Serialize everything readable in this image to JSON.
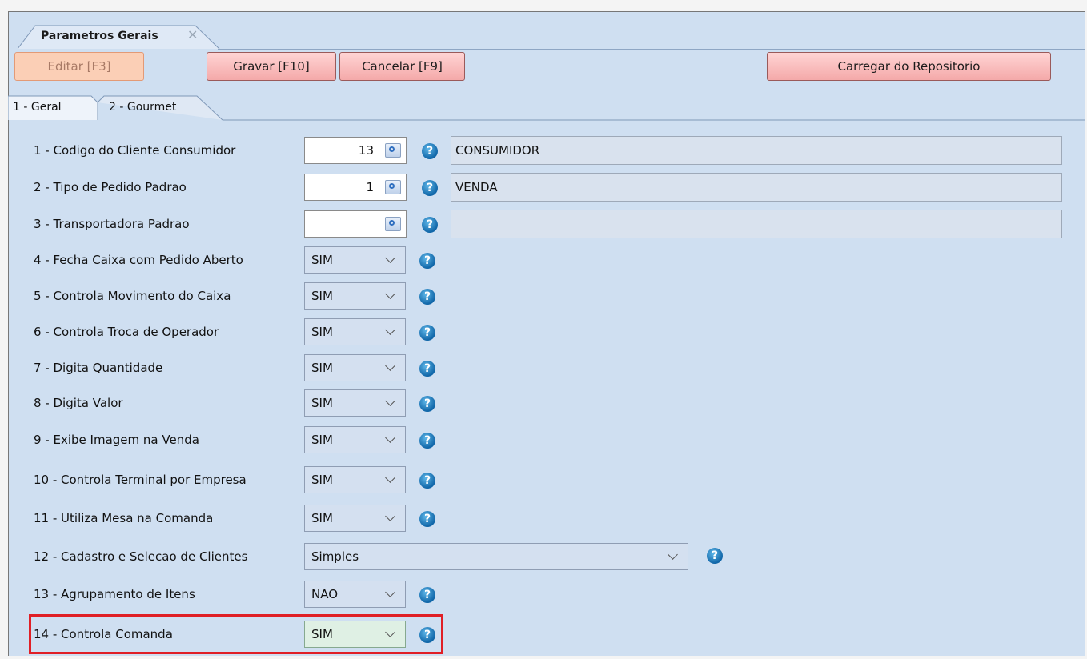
{
  "window": {
    "tab_title": "Parametros Gerais",
    "tab_close": "✕"
  },
  "toolbar": {
    "edit_label": "Editar [F3]",
    "save_label": "Gravar [F10]",
    "cancel_label": "Cancelar [F9]",
    "load_label": "Carregar do Repositorio"
  },
  "tabs": [
    {
      "label": "1 - Geral",
      "active": true
    },
    {
      "label": "2 - Gourmet",
      "active": false
    }
  ],
  "fields": [
    {
      "label": "1 - Codigo do Cliente Consumidor",
      "type": "lookup",
      "value": "13",
      "description": "CONSUMIDOR"
    },
    {
      "label": "2 - Tipo de Pedido Padrao",
      "type": "lookup",
      "value": "1",
      "description": "VENDA"
    },
    {
      "label": "3 - Transportadora Padrao",
      "type": "lookup",
      "value": "",
      "description": ""
    },
    {
      "label": "4 - Fecha Caixa com Pedido Aberto",
      "type": "select",
      "value": "SIM"
    },
    {
      "label": "5 - Controla Movimento do Caixa",
      "type": "select",
      "value": "SIM"
    },
    {
      "label": "6 - Controla Troca de Operador",
      "type": "select",
      "value": "SIM"
    },
    {
      "label": "7 - Digita Quantidade",
      "type": "select",
      "value": "SIM"
    },
    {
      "label": "8 - Digita Valor",
      "type": "select",
      "value": "SIM"
    },
    {
      "label": "9 - Exibe Imagem na Venda",
      "type": "select",
      "value": "SIM"
    },
    {
      "label": "10 - Controla Terminal por Empresa",
      "type": "select",
      "value": "SIM"
    },
    {
      "label": "11 - Utiliza Mesa na Comanda",
      "type": "select",
      "value": "SIM"
    },
    {
      "label": "12 - Cadastro e Selecao de Clientes",
      "type": "select-wide",
      "value": "Simples"
    },
    {
      "label": "13 - Agrupamento de Itens",
      "type": "select",
      "value": "NAO"
    },
    {
      "label": "14 - Controla Comanda",
      "type": "select",
      "value": "SIM",
      "highlighted": true
    }
  ],
  "colors": {
    "panel_bg": "#cfdff1",
    "highlight": "#e01f26",
    "button_red": "#f4a9a9"
  }
}
